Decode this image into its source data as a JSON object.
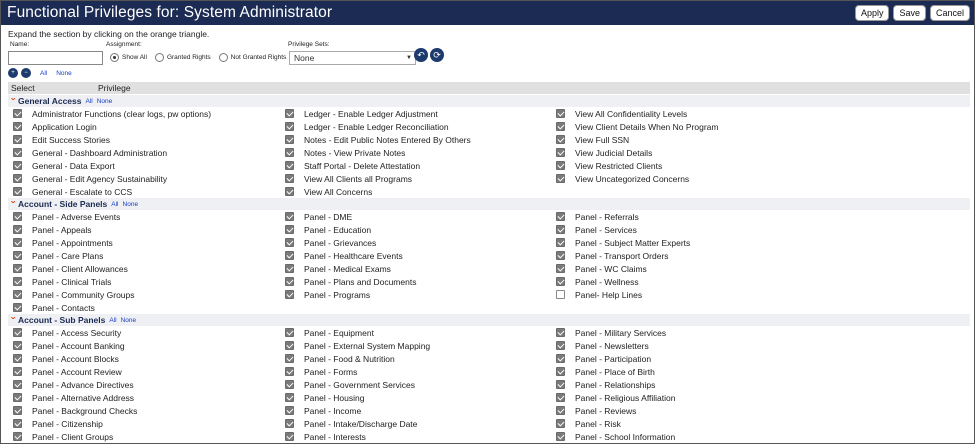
{
  "title": "Functional Privileges for: System Administrator",
  "buttons": {
    "apply": "Apply",
    "save": "Save",
    "cancel": "Cancel"
  },
  "instructions": "Expand the section by clicking on the orange triangle.",
  "filters": {
    "name_label": "Name:",
    "name_value": "",
    "assignment_label": "Assignment:",
    "assignment_options": [
      "Show All",
      "Granted Rights",
      "Not Granted Rights"
    ],
    "assignment_selected": "Show All",
    "privilege_sets_label": "Privilege Sets:",
    "privilege_sets_value": "None"
  },
  "expand_links": {
    "all": "All",
    "none": "None"
  },
  "header": {
    "select": "Select",
    "privilege": "Privilege"
  },
  "sections": [
    {
      "title": "General Access",
      "all": "All",
      "none": "None",
      "columns": [
        [
          {
            "label": "Administrator Functions (clear logs, pw options)",
            "checked": true
          },
          {
            "label": "Application Login",
            "checked": true
          },
          {
            "label": "Edit Success Stories",
            "checked": true
          },
          {
            "label": "General - Dashboard Administration",
            "checked": true
          },
          {
            "label": "General - Data Export",
            "checked": true
          },
          {
            "label": "General - Edit Agency Sustainability",
            "checked": true
          },
          {
            "label": "General - Escalate to CCS",
            "checked": true
          }
        ],
        [
          {
            "label": "Ledger - Enable Ledger Adjustment",
            "checked": true
          },
          {
            "label": "Ledger - Enable Ledger Reconciliation",
            "checked": true
          },
          {
            "label": "Notes - Edit Public Notes Entered By Others",
            "checked": true
          },
          {
            "label": "Notes - View Private Notes",
            "checked": true
          },
          {
            "label": "Staff Portal - Delete Attestation",
            "checked": true
          },
          {
            "label": "View All Clients all Programs",
            "checked": true
          },
          {
            "label": "View All Concerns",
            "checked": true
          }
        ],
        [
          {
            "label": "View All Confidentiality Levels",
            "checked": true
          },
          {
            "label": "View Client Details When No Program",
            "checked": true
          },
          {
            "label": "View Full SSN",
            "checked": true
          },
          {
            "label": "View Judicial Details",
            "checked": true
          },
          {
            "label": "View Restricted Clients",
            "checked": true
          },
          {
            "label": "View Uncategorized Concerns",
            "checked": true
          }
        ]
      ]
    },
    {
      "title": "Account - Side Panels",
      "all": "All",
      "none": "None",
      "columns": [
        [
          {
            "label": "Panel - Adverse Events",
            "checked": true
          },
          {
            "label": "Panel - Appeals",
            "checked": true
          },
          {
            "label": "Panel - Appointments",
            "checked": true
          },
          {
            "label": "Panel - Care Plans",
            "checked": true
          },
          {
            "label": "Panel - Client Allowances",
            "checked": true
          },
          {
            "label": "Panel - Clinical Trials",
            "checked": true
          },
          {
            "label": "Panel - Community Groups",
            "checked": true
          },
          {
            "label": "Panel - Contacts",
            "checked": true
          }
        ],
        [
          {
            "label": "Panel - DME",
            "checked": true
          },
          {
            "label": "Panel - Education",
            "checked": true
          },
          {
            "label": "Panel - Grievances",
            "checked": true
          },
          {
            "label": "Panel - Healthcare Events",
            "checked": true
          },
          {
            "label": "Panel - Medical Exams",
            "checked": true
          },
          {
            "label": "Panel - Plans and Documents",
            "checked": true
          },
          {
            "label": "Panel - Programs",
            "checked": true
          }
        ],
        [
          {
            "label": "Panel - Referrals",
            "checked": true
          },
          {
            "label": "Panel - Services",
            "checked": true
          },
          {
            "label": "Panel - Subject Matter Experts",
            "checked": true
          },
          {
            "label": "Panel - Transport Orders",
            "checked": true
          },
          {
            "label": "Panel - WC Claims",
            "checked": true
          },
          {
            "label": "Panel - Wellness",
            "checked": true
          },
          {
            "label": "Panel- Help Lines",
            "checked": false
          }
        ]
      ]
    },
    {
      "title": "Account - Sub Panels",
      "all": "All",
      "none": "None",
      "columns": [
        [
          {
            "label": "Panel - Access Security",
            "checked": true
          },
          {
            "label": "Panel - Account Banking",
            "checked": true
          },
          {
            "label": "Panel - Account Blocks",
            "checked": true
          },
          {
            "label": "Panel - Account Review",
            "checked": true
          },
          {
            "label": "Panel - Advance Directives",
            "checked": true
          },
          {
            "label": "Panel - Alternative Address",
            "checked": true
          },
          {
            "label": "Panel - Background Checks",
            "checked": true
          },
          {
            "label": "Panel - Citizenship",
            "checked": true
          },
          {
            "label": "Panel - Client Groups",
            "checked": true
          }
        ],
        [
          {
            "label": "Panel - Equipment",
            "checked": true
          },
          {
            "label": "Panel - External System Mapping",
            "checked": true
          },
          {
            "label": "Panel - Food & Nutrition",
            "checked": true
          },
          {
            "label": "Panel - Forms",
            "checked": true
          },
          {
            "label": "Panel - Government Services",
            "checked": true
          },
          {
            "label": "Panel - Housing",
            "checked": true
          },
          {
            "label": "Panel - Income",
            "checked": true
          },
          {
            "label": "Panel - Intake/Discharge Date",
            "checked": true
          },
          {
            "label": "Panel - Interests",
            "checked": true
          }
        ],
        [
          {
            "label": "Panel - Military Services",
            "checked": true
          },
          {
            "label": "Panel - Newsletters",
            "checked": true
          },
          {
            "label": "Panel - Participation",
            "checked": true
          },
          {
            "label": "Panel - Place of Birth",
            "checked": true
          },
          {
            "label": "Panel - Relationships",
            "checked": true
          },
          {
            "label": "Panel - Religious Affiliation",
            "checked": true
          },
          {
            "label": "Panel - Reviews",
            "checked": true
          },
          {
            "label": "Panel - Risk",
            "checked": true
          },
          {
            "label": "Panel - School Information",
            "checked": true
          }
        ]
      ]
    }
  ]
}
